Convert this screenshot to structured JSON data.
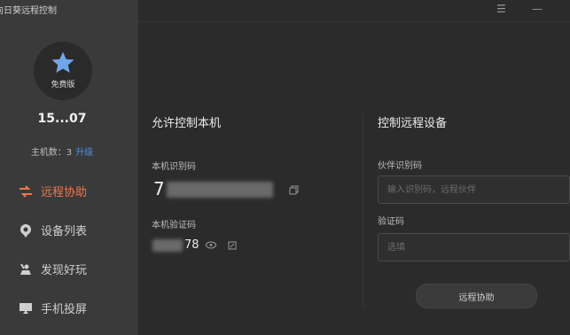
{
  "app": {
    "title": "向日葵远程控制"
  },
  "window": {
    "menu_icon": "menu-icon",
    "min_icon": "minimize-icon"
  },
  "user": {
    "badge_icon": "star-icon",
    "level": "免费版",
    "account": "15...07",
    "host_count_text": "主机数：3",
    "upgrade": "升级"
  },
  "sidebar": {
    "items": [
      {
        "label": "远程协助",
        "icon": "remote-assist-icon",
        "active": true
      },
      {
        "label": "设备列表",
        "icon": "device-list-icon",
        "active": false
      },
      {
        "label": "发现好玩",
        "icon": "discover-icon",
        "active": false
      },
      {
        "label": "手机投屏",
        "icon": "phone-cast-icon",
        "active": false
      }
    ]
  },
  "allow": {
    "title": "允许控制本机",
    "id_label": "本机识别码",
    "id_value_visible": "7",
    "verify_label": "本机验证码",
    "verify_value_visible": "78"
  },
  "control": {
    "title": "控制远程设备",
    "partner_label": "伙伴识别码",
    "partner_placeholder": "输入识别码，远程伙伴",
    "code_label": "验证码",
    "code_placeholder": "选填",
    "button": "远程协助"
  },
  "colors": {
    "accent": "#f0764a",
    "link": "#4e8fe0",
    "sidebar": "#3a3a3a",
    "main": "#2b2b2b"
  }
}
